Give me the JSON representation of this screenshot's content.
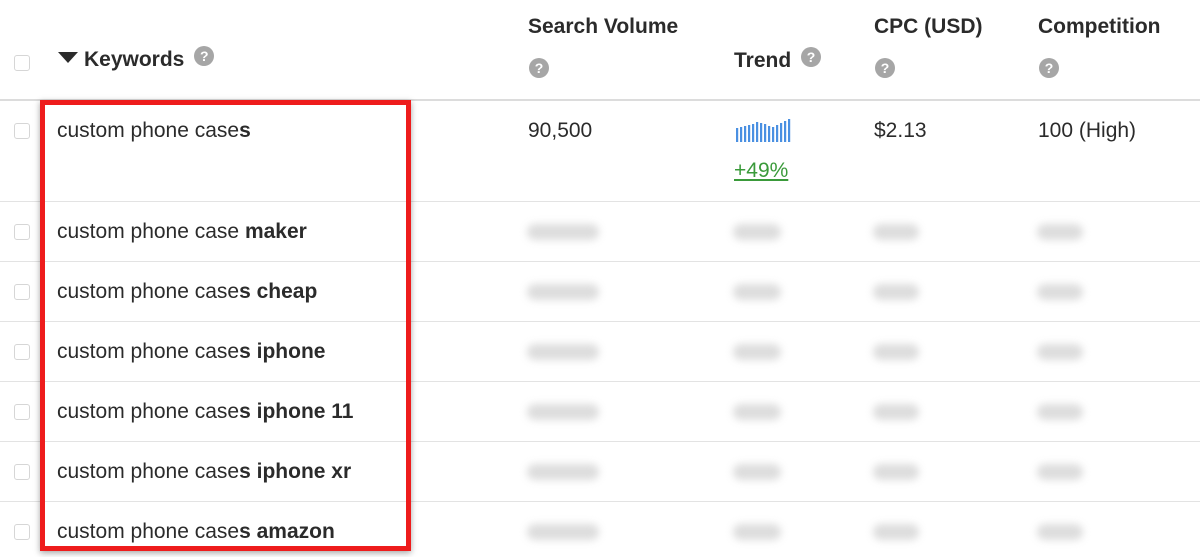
{
  "header": {
    "keywords_label": "Keywords",
    "search_volume_label": "Search Volume",
    "trend_label": "Trend",
    "cpc_label": "CPC (USD)",
    "competition_label": "Competition",
    "help_glyph": "?"
  },
  "rows": [
    {
      "prefix": "custom phone case",
      "suffix": "s",
      "volume": "90,500",
      "trend_pct": "+49%",
      "cpc": "$2.13",
      "competition": "100 (High)"
    },
    {
      "prefix": "custom phone case ",
      "suffix": "maker"
    },
    {
      "prefix": "custom phone case",
      "suffix": "s cheap"
    },
    {
      "prefix": "custom phone case",
      "suffix": "s iphone"
    },
    {
      "prefix": "custom phone case",
      "suffix": "s iphone 11"
    },
    {
      "prefix": "custom phone case",
      "suffix": "s iphone xr"
    },
    {
      "prefix": "custom phone case",
      "suffix": "s amazon"
    }
  ],
  "colors": {
    "highlight_box": "#ee1c1c",
    "trend_bars": "#4a90e2",
    "trend_positive": "#3a9a3a"
  }
}
